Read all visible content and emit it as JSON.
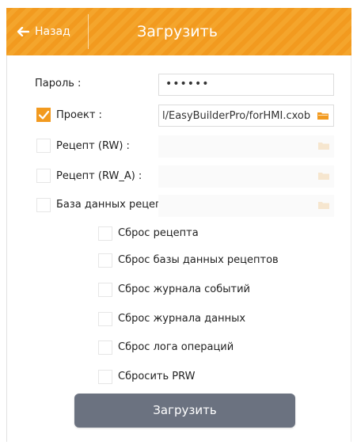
{
  "header": {
    "back_label": "Назад",
    "title": "Загрузить",
    "accent_color": "#f29a1f"
  },
  "form": {
    "password": {
      "label": "Пароль :",
      "value": "••••••"
    },
    "project": {
      "label": "Проект :",
      "checked": true,
      "path": "l/EasyBuilderPro/forHMI.cxob"
    },
    "recipe_rw": {
      "label": "Рецепт (RW) :",
      "checked": false
    },
    "recipe_rw_a": {
      "label": "Рецепт (RW_A) :",
      "checked": false
    },
    "recipe_db": {
      "label": "База данных рецептов :",
      "checked": false
    }
  },
  "reset_options": [
    {
      "label": "Сброс рецепта",
      "checked": false
    },
    {
      "label": "Сброс базы данных рецептов",
      "checked": false
    },
    {
      "label": "Сброс журнала событий",
      "checked": false
    },
    {
      "label": "Сброс журнала данных",
      "checked": false
    },
    {
      "label": "Сброс лога операций",
      "checked": false
    },
    {
      "label": "Сбросить PRW",
      "checked": false
    }
  ],
  "footer": {
    "upload_label": "Загрузить"
  },
  "icons": {
    "back": "arrow-left-icon",
    "folder": "folder-icon",
    "check": "checkmark-icon"
  }
}
